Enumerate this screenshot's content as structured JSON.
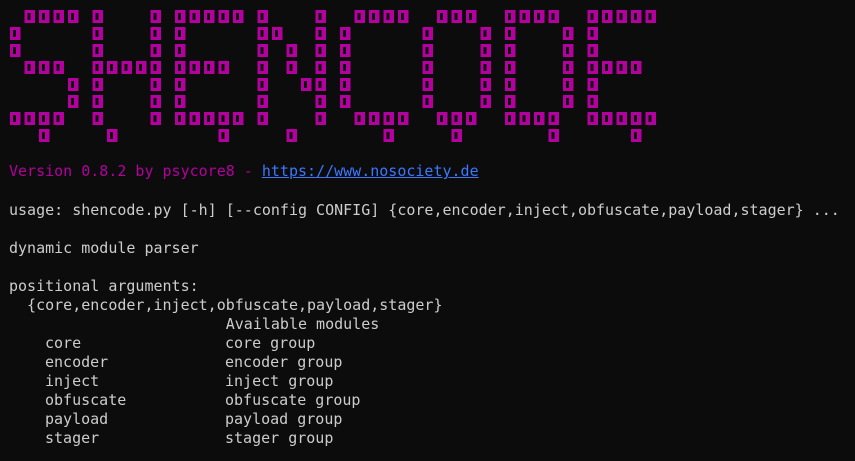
{
  "banner": {
    "text": "SHENCODE",
    "color": "#b4009e"
  },
  "version": {
    "prefix": "Version 0.8.2 by psycore8 - ",
    "url": "https://www.nosociety.de"
  },
  "output": {
    "usage": "usage: shencode.py [-h] [--config CONFIG] {core,encoder,inject,obfuscate,payload,stager} ...",
    "description": "dynamic module parser",
    "positional_header": "positional arguments:",
    "choices": "  {core,encoder,inject,obfuscate,payload,stager}",
    "available": "                        Available modules",
    "modules": [
      {
        "name": "core",
        "desc": "core group"
      },
      {
        "name": "encoder",
        "desc": "encoder group"
      },
      {
        "name": "inject",
        "desc": "inject group"
      },
      {
        "name": "obfuscate",
        "desc": "obfuscate group"
      },
      {
        "name": "payload",
        "desc": "payload group"
      },
      {
        "name": "stager",
        "desc": "stager group"
      }
    ]
  }
}
